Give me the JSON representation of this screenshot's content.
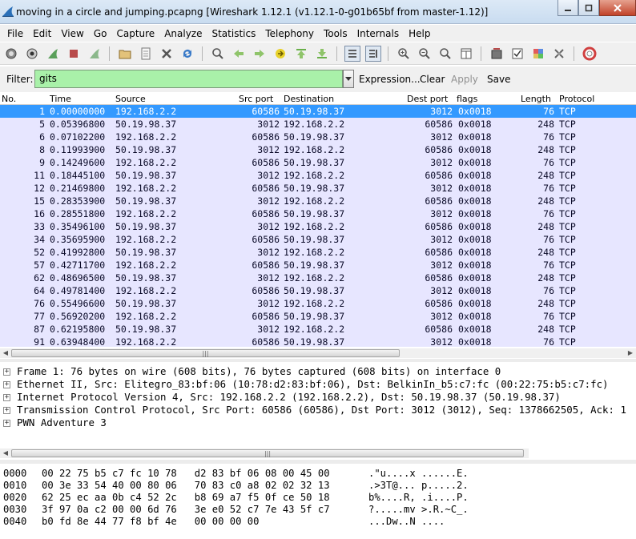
{
  "window": {
    "title": "moving in a circle and jumping.pcapng   [Wireshark 1.12.1  (v1.12.1-0-g01b65bf from master-1.12)]"
  },
  "menu": [
    "File",
    "Edit",
    "View",
    "Go",
    "Capture",
    "Analyze",
    "Statistics",
    "Telephony",
    "Tools",
    "Internals",
    "Help"
  ],
  "filter": {
    "label": "Filter:",
    "value": "gits",
    "expression": "Expression...",
    "clear": "Clear",
    "apply": "Apply",
    "save": "Save"
  },
  "columns": {
    "no": "No.",
    "time": "Time",
    "source": "Source",
    "srcport": "Src port",
    "destination": "Destination",
    "dstport": "Dest port",
    "flags": "flags",
    "length": "Length",
    "protocol": "Protocol"
  },
  "packets": [
    {
      "no": "1",
      "time": "0.00000000",
      "src": "192.168.2.2",
      "sport": "60586",
      "dst": "50.19.98.37",
      "dport": "3012",
      "flags": "0x0018",
      "len": "76",
      "proto": "TCP"
    },
    {
      "no": "5",
      "time": "0.05396800",
      "src": "50.19.98.37",
      "sport": "3012",
      "dst": "192.168.2.2",
      "dport": "60586",
      "flags": "0x0018",
      "len": "248",
      "proto": "TCP"
    },
    {
      "no": "6",
      "time": "0.07102200",
      "src": "192.168.2.2",
      "sport": "60586",
      "dst": "50.19.98.37",
      "dport": "3012",
      "flags": "0x0018",
      "len": "76",
      "proto": "TCP"
    },
    {
      "no": "8",
      "time": "0.11993900",
      "src": "50.19.98.37",
      "sport": "3012",
      "dst": "192.168.2.2",
      "dport": "60586",
      "flags": "0x0018",
      "len": "248",
      "proto": "TCP"
    },
    {
      "no": "9",
      "time": "0.14249600",
      "src": "192.168.2.2",
      "sport": "60586",
      "dst": "50.19.98.37",
      "dport": "3012",
      "flags": "0x0018",
      "len": "76",
      "proto": "TCP"
    },
    {
      "no": "11",
      "time": "0.18445100",
      "src": "50.19.98.37",
      "sport": "3012",
      "dst": "192.168.2.2",
      "dport": "60586",
      "flags": "0x0018",
      "len": "248",
      "proto": "TCP"
    },
    {
      "no": "12",
      "time": "0.21469800",
      "src": "192.168.2.2",
      "sport": "60586",
      "dst": "50.19.98.37",
      "dport": "3012",
      "flags": "0x0018",
      "len": "76",
      "proto": "TCP"
    },
    {
      "no": "15",
      "time": "0.28353900",
      "src": "50.19.98.37",
      "sport": "3012",
      "dst": "192.168.2.2",
      "dport": "60586",
      "flags": "0x0018",
      "len": "248",
      "proto": "TCP"
    },
    {
      "no": "16",
      "time": "0.28551800",
      "src": "192.168.2.2",
      "sport": "60586",
      "dst": "50.19.98.37",
      "dport": "3012",
      "flags": "0x0018",
      "len": "76",
      "proto": "TCP"
    },
    {
      "no": "33",
      "time": "0.35496100",
      "src": "50.19.98.37",
      "sport": "3012",
      "dst": "192.168.2.2",
      "dport": "60586",
      "flags": "0x0018",
      "len": "248",
      "proto": "TCP"
    },
    {
      "no": "34",
      "time": "0.35695900",
      "src": "192.168.2.2",
      "sport": "60586",
      "dst": "50.19.98.37",
      "dport": "3012",
      "flags": "0x0018",
      "len": "76",
      "proto": "TCP"
    },
    {
      "no": "52",
      "time": "0.41992800",
      "src": "50.19.98.37",
      "sport": "3012",
      "dst": "192.168.2.2",
      "dport": "60586",
      "flags": "0x0018",
      "len": "248",
      "proto": "TCP"
    },
    {
      "no": "57",
      "time": "0.42711700",
      "src": "192.168.2.2",
      "sport": "60586",
      "dst": "50.19.98.37",
      "dport": "3012",
      "flags": "0x0018",
      "len": "76",
      "proto": "TCP"
    },
    {
      "no": "62",
      "time": "0.48696500",
      "src": "50.19.98.37",
      "sport": "3012",
      "dst": "192.168.2.2",
      "dport": "60586",
      "flags": "0x0018",
      "len": "248",
      "proto": "TCP"
    },
    {
      "no": "64",
      "time": "0.49781400",
      "src": "192.168.2.2",
      "sport": "60586",
      "dst": "50.19.98.37",
      "dport": "3012",
      "flags": "0x0018",
      "len": "76",
      "proto": "TCP"
    },
    {
      "no": "76",
      "time": "0.55496600",
      "src": "50.19.98.37",
      "sport": "3012",
      "dst": "192.168.2.2",
      "dport": "60586",
      "flags": "0x0018",
      "len": "248",
      "proto": "TCP"
    },
    {
      "no": "77",
      "time": "0.56920200",
      "src": "192.168.2.2",
      "sport": "60586",
      "dst": "50.19.98.37",
      "dport": "3012",
      "flags": "0x0018",
      "len": "76",
      "proto": "TCP"
    },
    {
      "no": "87",
      "time": "0.62195800",
      "src": "50.19.98.37",
      "sport": "3012",
      "dst": "192.168.2.2",
      "dport": "60586",
      "flags": "0x0018",
      "len": "248",
      "proto": "TCP"
    },
    {
      "no": "91",
      "time": "0.63948400",
      "src": "192.168.2.2",
      "sport": "60586",
      "dst": "50.19.98.37",
      "dport": "3012",
      "flags": "0x0018",
      "len": "76",
      "proto": "TCP"
    }
  ],
  "selected_row": 0,
  "details": [
    "Frame 1: 76 bytes on wire (608 bits), 76 bytes captured (608 bits) on interface 0",
    "Ethernet II, Src: Elitegro_83:bf:06 (10:78:d2:83:bf:06), Dst: BelkinIn_b5:c7:fc (00:22:75:b5:c7:fc)",
    "Internet Protocol Version 4, Src: 192.168.2.2 (192.168.2.2), Dst: 50.19.98.37 (50.19.98.37)",
    "Transmission Control Protocol, Src Port: 60586 (60586), Dst Port: 3012 (3012), Seq: 1378662505, Ack: 1",
    "PWN Adventure 3"
  ],
  "hexdump": [
    {
      "off": "0000",
      "bytes": "00 22 75 b5 c7 fc 10 78   d2 83 bf 06 08 00 45 00",
      "ascii": ".\"u....x ......E."
    },
    {
      "off": "0010",
      "bytes": "00 3e 33 54 40 00 80 06   70 83 c0 a8 02 02 32 13",
      "ascii": ".>3T@... p.....2."
    },
    {
      "off": "0020",
      "bytes": "62 25 ec aa 0b c4 52 2c   b8 69 a7 f5 0f ce 50 18",
      "ascii": "b%....R, .i....P."
    },
    {
      "off": "0030",
      "bytes": "3f 97 0a c2 00 00 6d 76   3e e0 52 c7 7e 43 5f c7",
      "ascii": "?.....mv >.R.~C_."
    },
    {
      "off": "0040",
      "bytes": "b0 fd 8e 44 77 f8 bf 4e   00 00 00 00",
      "ascii": "...Dw..N ...."
    }
  ],
  "colors": {
    "row_bg": "#e7e6ff",
    "selected_bg": "#3399ff",
    "filter_ok": "#a9f1a9"
  },
  "toolbar_icons": [
    "interface-list-icon",
    "capture-options-icon",
    "start-capture-icon",
    "stop-capture-icon",
    "restart-capture-icon",
    "open-file-icon",
    "save-file-icon",
    "close-file-icon",
    "reload-icon",
    "find-icon",
    "go-back-icon",
    "go-forward-icon",
    "go-to-packet-icon",
    "go-first-icon",
    "go-last-icon",
    "colorize-icon",
    "autoscroll-icon",
    "zoom-in-icon",
    "zoom-out-icon",
    "zoom-normal-icon",
    "resize-columns-icon",
    "capture-filters-icon",
    "display-filters-icon",
    "coloring-rules-icon",
    "preferences-icon",
    "help-icon"
  ]
}
